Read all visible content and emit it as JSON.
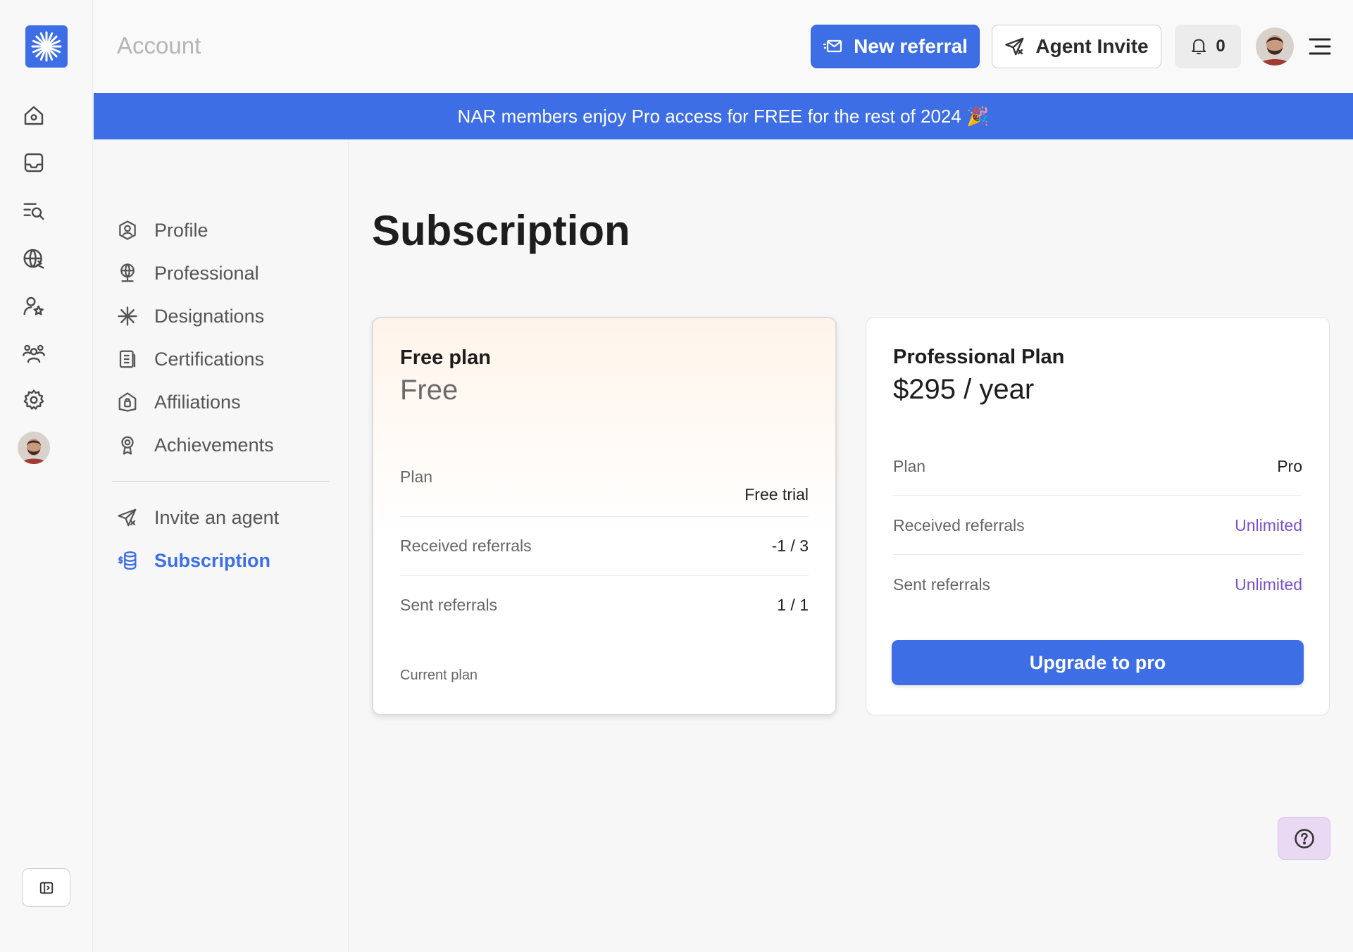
{
  "header": {
    "title": "Account",
    "new_referral_label": "New referral",
    "agent_invite_label": "Agent Invite",
    "notification_count": "0"
  },
  "banner": {
    "text": "NAR members enjoy Pro access for FREE for the rest of 2024 🎉"
  },
  "rail": {
    "icons": [
      "home-icon",
      "inbox-icon",
      "search-list-icon",
      "globe-icon",
      "user-star-icon",
      "users-icon",
      "gear-icon"
    ]
  },
  "settings_nav": {
    "items": [
      {
        "label": "Profile",
        "icon": "user-circle-icon"
      },
      {
        "label": "Professional",
        "icon": "globe-pin-icon"
      },
      {
        "label": "Designations",
        "icon": "asterisk-icon"
      },
      {
        "label": "Certifications",
        "icon": "document-icon"
      },
      {
        "label": "Affiliations",
        "icon": "badge-icon"
      },
      {
        "label": "Achievements",
        "icon": "award-icon"
      }
    ],
    "secondary": [
      {
        "label": "Invite an agent",
        "icon": "send-icon"
      },
      {
        "label": "Subscription",
        "icon": "coins-icon",
        "active": true
      }
    ]
  },
  "main": {
    "title": "Subscription",
    "free_plan": {
      "name": "Free plan",
      "price": "Free",
      "rows": [
        {
          "label": "Plan",
          "value": "Free trial"
        },
        {
          "label": "Received referrals",
          "value": "-1 / 3"
        },
        {
          "label": "Sent referrals",
          "value": "1 / 1"
        }
      ],
      "footer": "Current plan"
    },
    "pro_plan": {
      "name": "Professional Plan",
      "price": "$295 / year",
      "rows": [
        {
          "label": "Plan",
          "value": "Pro"
        },
        {
          "label": "Received referrals",
          "value": "Unlimited"
        },
        {
          "label": "Sent referrals",
          "value": "Unlimited"
        }
      ],
      "cta": "Upgrade to pro"
    }
  },
  "colors": {
    "accent": "#3d6ee6",
    "unlimited": "#7a4fd0",
    "help_bg": "#ead9f3"
  }
}
